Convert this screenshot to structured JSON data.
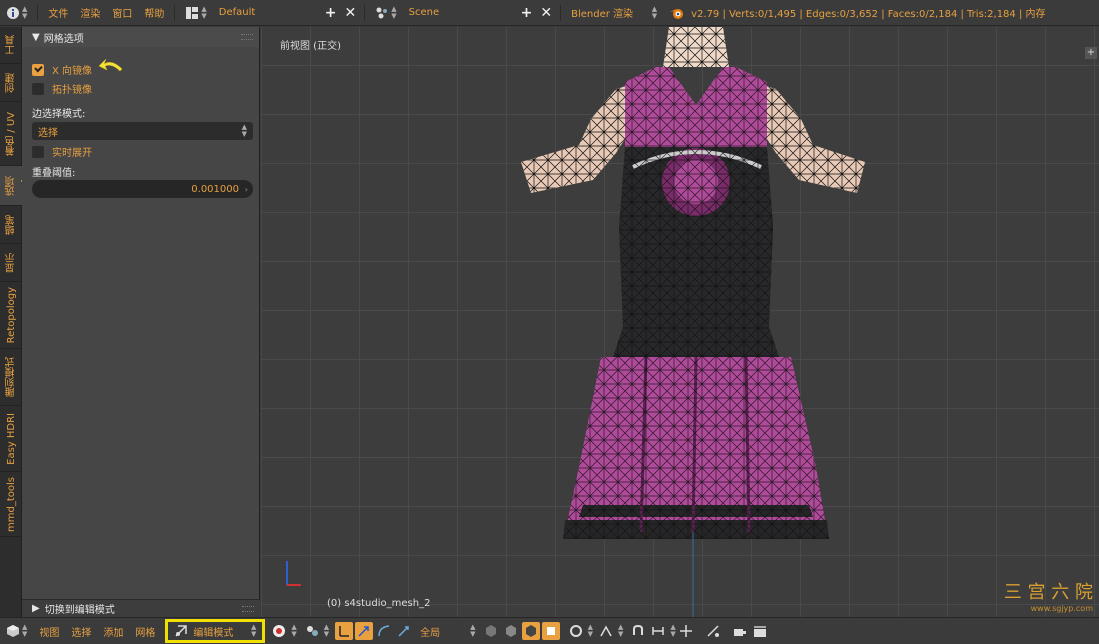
{
  "topbar": {
    "menus": [
      "文件",
      "渲染",
      "窗口",
      "帮助"
    ],
    "screen_layout": "Default",
    "scene": "Scene",
    "render_engine": "Blender 渲染",
    "stats": "v2.79 | Verts:0/1,495 | Edges:0/3,652 | Faces:0/2,184 | Tris:2,184 | 内存"
  },
  "vtabs": [
    "工具",
    "创建",
    "着色 / UV",
    "选项",
    "蜡笔",
    "显示",
    "Retopology",
    "雕刻模式",
    "Easy HDRI",
    "mmd_tools"
  ],
  "toolshelf": {
    "panel_title": "网格选项",
    "x_mirror": {
      "label": "X 向镜像",
      "checked": true
    },
    "topo_mirror": {
      "label": "拓扑镜像",
      "checked": false
    },
    "edge_select_label": "边选择模式:",
    "edge_select_value": "选择",
    "live_unwrap": {
      "label": "实时展开",
      "checked": false
    },
    "double_threshold_label": "重叠阈值:",
    "double_threshold_value": "0.001000",
    "footer_label": "切换到编辑模式"
  },
  "viewport": {
    "view_name": "前视图 (正交)",
    "object_name": "(0) s4studio_mesh_2",
    "watermark": "三 宫 六 院",
    "watermark_url": "www.sgjyp.com"
  },
  "bottombar": {
    "menus": [
      "视图",
      "选择",
      "添加",
      "网格"
    ],
    "mode": "编辑模式",
    "pivot": "全局"
  },
  "colors": {
    "accent": "#e8a040",
    "highlight_box": "#f0e000",
    "dress_pink": "#b04a9a",
    "dress_dark": "#262628"
  }
}
